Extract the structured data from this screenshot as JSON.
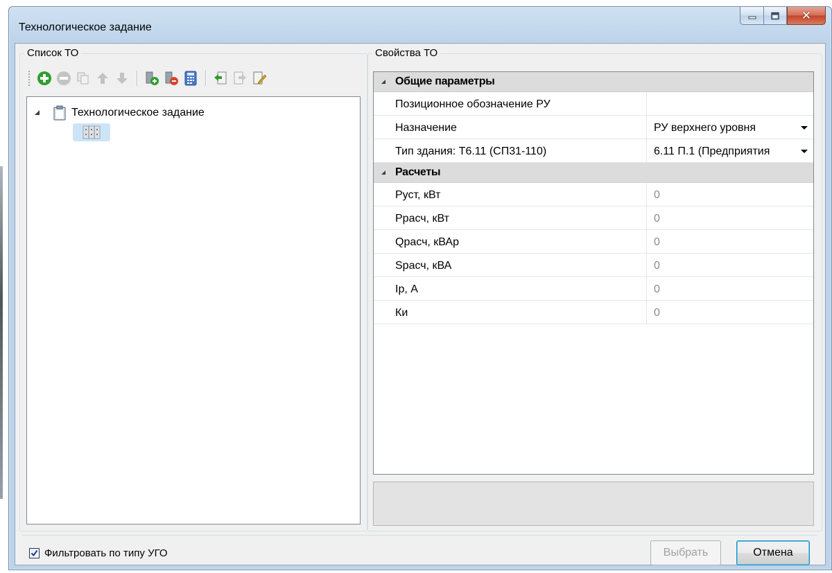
{
  "window": {
    "title": "Технологическое задание"
  },
  "left_panel": {
    "title": "Список ТО",
    "toolbar": [
      {
        "name": "add-icon",
        "color": "#2e9e2e"
      },
      {
        "name": "remove-icon",
        "color": "#b0b0b0"
      },
      {
        "name": "copy-icon",
        "color": "#b0b0b0"
      },
      {
        "name": "move-up-icon",
        "color": "#b0b0b0"
      },
      {
        "name": "move-down-icon",
        "color": "#b0b0b0"
      },
      {
        "name": "add-item-icon",
        "color": "#2e9e2e"
      },
      {
        "name": "remove-item-icon",
        "color": "#d9432b"
      },
      {
        "name": "calculator-icon",
        "color": "#4a78c8"
      },
      {
        "name": "import-icon",
        "color": "#2e9e2e"
      },
      {
        "name": "export-icon",
        "color": "#b0b0b0"
      },
      {
        "name": "edit-icon",
        "color": "#d8a020"
      }
    ],
    "tree": {
      "root_label": "Технологическое задание",
      "child_icon": "cabinet-icon"
    }
  },
  "right_panel": {
    "title": "Свойства ТО",
    "categories": [
      {
        "label": "Общие параметры",
        "rows": [
          {
            "name": "Позиционное обозначение РУ",
            "value": ""
          },
          {
            "name": "Назначение",
            "value": "РУ верхнего уровня"
          },
          {
            "name": "Тип здания: Т6.11 (СП31-110)",
            "value": "6.11 П.1 (Предприятия"
          }
        ]
      },
      {
        "label": "Расчеты",
        "rows": [
          {
            "name": "Руст, кВт",
            "value": "0"
          },
          {
            "name": "Ррасч, кВт",
            "value": "0"
          },
          {
            "name": "Qрасч,  кВАр",
            "value": "0"
          },
          {
            "name": "Sрасч, кВА",
            "value": "0"
          },
          {
            "name": "Iр, А",
            "value": "0"
          },
          {
            "name": "Ки",
            "value": "0"
          }
        ]
      }
    ]
  },
  "footer": {
    "filter_label": "Фильтровать по типу УГО",
    "filter_checked": true,
    "select_label": "Выбрать",
    "cancel_label": "Отмена"
  }
}
